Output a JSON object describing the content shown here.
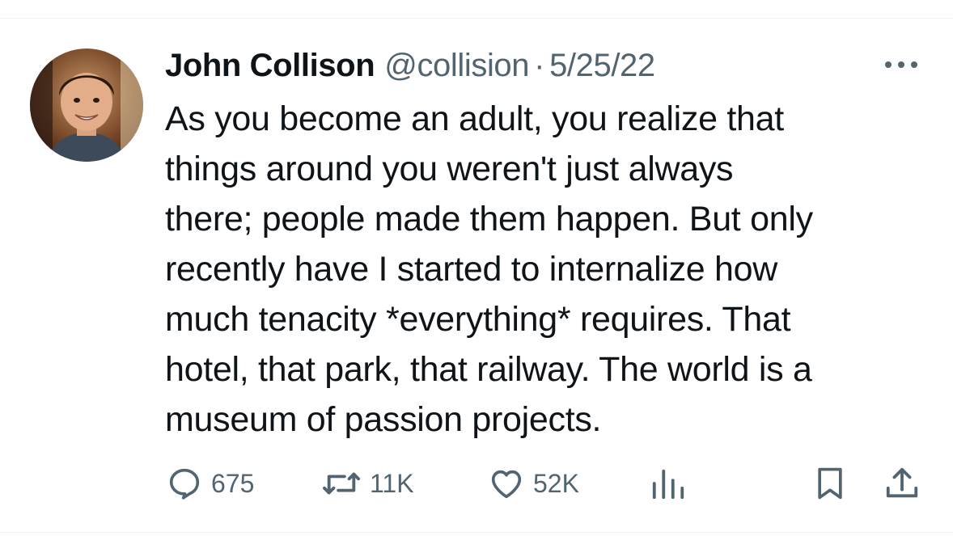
{
  "author": {
    "name": "John Collison",
    "handle": "@collision",
    "separator": "·",
    "date": "5/25/22"
  },
  "tweet": {
    "lines": [
      "As you become an adult, you realize that",
      "things around you weren't just always",
      "there; people made them happen. But only",
      "recently have I started to internalize how",
      "much tenacity *everything* requires. That",
      "hotel, that park, that railway. The world is a",
      "museum of passion projects."
    ]
  },
  "actions": {
    "reply_count": "675",
    "retweet_count": "11K",
    "like_count": "52K"
  },
  "icons": {
    "more": "more-icon",
    "reply": "reply-icon",
    "retweet": "retweet-icon",
    "like": "heart-icon",
    "views": "views-icon",
    "bookmark": "bookmark-icon",
    "share": "share-icon"
  },
  "colors": {
    "text_primary": "#0f1419",
    "text_secondary": "#536471",
    "divider": "#eff3f4"
  }
}
